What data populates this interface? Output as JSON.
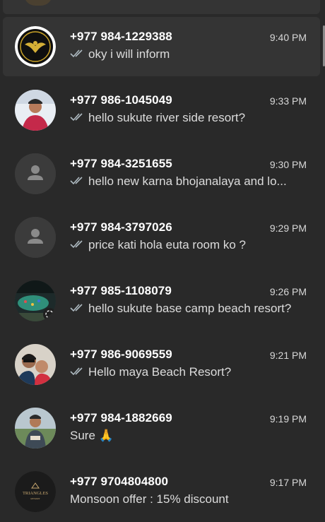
{
  "chats": [
    {
      "name": "+977 984-1229388",
      "time": "9:40 PM",
      "preview": "oky i will inform",
      "ticks": true,
      "avatar": "logo-avatar"
    },
    {
      "name": "+977 986-1045049",
      "time": "9:33 PM",
      "preview": "hello sukute river side resort?",
      "ticks": true,
      "avatar": "photo-avatar"
    },
    {
      "name": "+977 984-3251655",
      "time": "9:30 PM",
      "preview": "hello new karna bhojanalaya and lo...",
      "ticks": true,
      "avatar": "default-avatar"
    },
    {
      "name": "+977 984-3797026",
      "time": "9:29 PM",
      "preview": "price kati hola euta room ko ?",
      "ticks": true,
      "avatar": "default-avatar"
    },
    {
      "name": "+977 985-1108079",
      "time": "9:26 PM",
      "preview": "hello sukute base camp beach resort?",
      "ticks": true,
      "avatar": "photo-avatar"
    },
    {
      "name": "+977 986-9069559",
      "time": "9:21 PM",
      "preview": "Hello maya Beach Resort?",
      "ticks": true,
      "avatar": "photo-avatar"
    },
    {
      "name": "+977 984-1882669",
      "time": "9:19 PM",
      "preview": "Sure 🙏",
      "ticks": false,
      "avatar": "photo-avatar"
    },
    {
      "name": "+977 9704804800",
      "time": "9:17 PM",
      "preview": "Monsoon offer : 15% discount",
      "ticks": false,
      "avatar": "logo-avatar"
    }
  ],
  "avatar_text": {
    "triangles_line1": "TRIANGLES",
    "triangles_line2": "RESORT"
  },
  "colors": {
    "background": "#292929",
    "selected": "#343434",
    "tick": "#aebac1"
  }
}
